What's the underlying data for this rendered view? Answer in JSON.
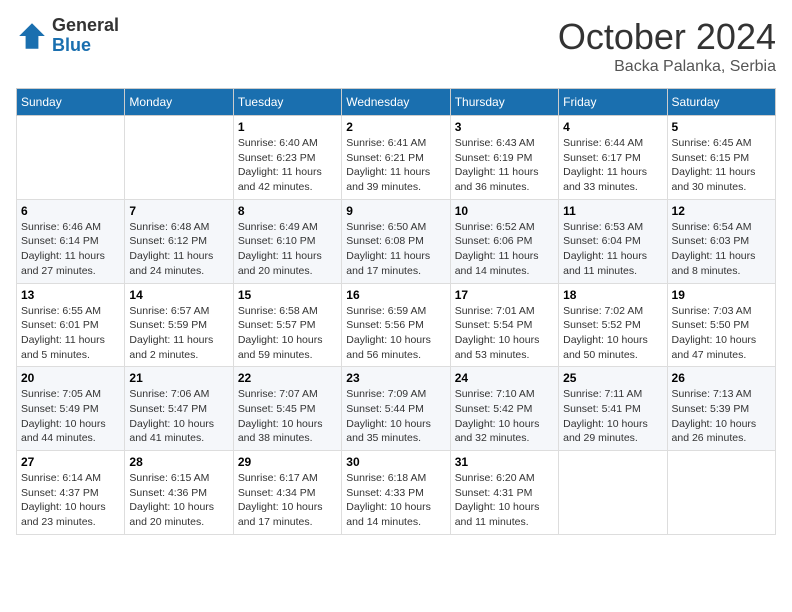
{
  "logo": {
    "general": "General",
    "blue": "Blue"
  },
  "title": {
    "month": "October 2024",
    "location": "Backa Palanka, Serbia"
  },
  "weekdays": [
    "Sunday",
    "Monday",
    "Tuesday",
    "Wednesday",
    "Thursday",
    "Friday",
    "Saturday"
  ],
  "weeks": [
    [
      {
        "day": "",
        "sunrise": "",
        "sunset": "",
        "daylight": ""
      },
      {
        "day": "",
        "sunrise": "",
        "sunset": "",
        "daylight": ""
      },
      {
        "day": "1",
        "sunrise": "Sunrise: 6:40 AM",
        "sunset": "Sunset: 6:23 PM",
        "daylight": "Daylight: 11 hours and 42 minutes."
      },
      {
        "day": "2",
        "sunrise": "Sunrise: 6:41 AM",
        "sunset": "Sunset: 6:21 PM",
        "daylight": "Daylight: 11 hours and 39 minutes."
      },
      {
        "day": "3",
        "sunrise": "Sunrise: 6:43 AM",
        "sunset": "Sunset: 6:19 PM",
        "daylight": "Daylight: 11 hours and 36 minutes."
      },
      {
        "day": "4",
        "sunrise": "Sunrise: 6:44 AM",
        "sunset": "Sunset: 6:17 PM",
        "daylight": "Daylight: 11 hours and 33 minutes."
      },
      {
        "day": "5",
        "sunrise": "Sunrise: 6:45 AM",
        "sunset": "Sunset: 6:15 PM",
        "daylight": "Daylight: 11 hours and 30 minutes."
      }
    ],
    [
      {
        "day": "6",
        "sunrise": "Sunrise: 6:46 AM",
        "sunset": "Sunset: 6:14 PM",
        "daylight": "Daylight: 11 hours and 27 minutes."
      },
      {
        "day": "7",
        "sunrise": "Sunrise: 6:48 AM",
        "sunset": "Sunset: 6:12 PM",
        "daylight": "Daylight: 11 hours and 24 minutes."
      },
      {
        "day": "8",
        "sunrise": "Sunrise: 6:49 AM",
        "sunset": "Sunset: 6:10 PM",
        "daylight": "Daylight: 11 hours and 20 minutes."
      },
      {
        "day": "9",
        "sunrise": "Sunrise: 6:50 AM",
        "sunset": "Sunset: 6:08 PM",
        "daylight": "Daylight: 11 hours and 17 minutes."
      },
      {
        "day": "10",
        "sunrise": "Sunrise: 6:52 AM",
        "sunset": "Sunset: 6:06 PM",
        "daylight": "Daylight: 11 hours and 14 minutes."
      },
      {
        "day": "11",
        "sunrise": "Sunrise: 6:53 AM",
        "sunset": "Sunset: 6:04 PM",
        "daylight": "Daylight: 11 hours and 11 minutes."
      },
      {
        "day": "12",
        "sunrise": "Sunrise: 6:54 AM",
        "sunset": "Sunset: 6:03 PM",
        "daylight": "Daylight: 11 hours and 8 minutes."
      }
    ],
    [
      {
        "day": "13",
        "sunrise": "Sunrise: 6:55 AM",
        "sunset": "Sunset: 6:01 PM",
        "daylight": "Daylight: 11 hours and 5 minutes."
      },
      {
        "day": "14",
        "sunrise": "Sunrise: 6:57 AM",
        "sunset": "Sunset: 5:59 PM",
        "daylight": "Daylight: 11 hours and 2 minutes."
      },
      {
        "day": "15",
        "sunrise": "Sunrise: 6:58 AM",
        "sunset": "Sunset: 5:57 PM",
        "daylight": "Daylight: 10 hours and 59 minutes."
      },
      {
        "day": "16",
        "sunrise": "Sunrise: 6:59 AM",
        "sunset": "Sunset: 5:56 PM",
        "daylight": "Daylight: 10 hours and 56 minutes."
      },
      {
        "day": "17",
        "sunrise": "Sunrise: 7:01 AM",
        "sunset": "Sunset: 5:54 PM",
        "daylight": "Daylight: 10 hours and 53 minutes."
      },
      {
        "day": "18",
        "sunrise": "Sunrise: 7:02 AM",
        "sunset": "Sunset: 5:52 PM",
        "daylight": "Daylight: 10 hours and 50 minutes."
      },
      {
        "day": "19",
        "sunrise": "Sunrise: 7:03 AM",
        "sunset": "Sunset: 5:50 PM",
        "daylight": "Daylight: 10 hours and 47 minutes."
      }
    ],
    [
      {
        "day": "20",
        "sunrise": "Sunrise: 7:05 AM",
        "sunset": "Sunset: 5:49 PM",
        "daylight": "Daylight: 10 hours and 44 minutes."
      },
      {
        "day": "21",
        "sunrise": "Sunrise: 7:06 AM",
        "sunset": "Sunset: 5:47 PM",
        "daylight": "Daylight: 10 hours and 41 minutes."
      },
      {
        "day": "22",
        "sunrise": "Sunrise: 7:07 AM",
        "sunset": "Sunset: 5:45 PM",
        "daylight": "Daylight: 10 hours and 38 minutes."
      },
      {
        "day": "23",
        "sunrise": "Sunrise: 7:09 AM",
        "sunset": "Sunset: 5:44 PM",
        "daylight": "Daylight: 10 hours and 35 minutes."
      },
      {
        "day": "24",
        "sunrise": "Sunrise: 7:10 AM",
        "sunset": "Sunset: 5:42 PM",
        "daylight": "Daylight: 10 hours and 32 minutes."
      },
      {
        "day": "25",
        "sunrise": "Sunrise: 7:11 AM",
        "sunset": "Sunset: 5:41 PM",
        "daylight": "Daylight: 10 hours and 29 minutes."
      },
      {
        "day": "26",
        "sunrise": "Sunrise: 7:13 AM",
        "sunset": "Sunset: 5:39 PM",
        "daylight": "Daylight: 10 hours and 26 minutes."
      }
    ],
    [
      {
        "day": "27",
        "sunrise": "Sunrise: 6:14 AM",
        "sunset": "Sunset: 4:37 PM",
        "daylight": "Daylight: 10 hours and 23 minutes."
      },
      {
        "day": "28",
        "sunrise": "Sunrise: 6:15 AM",
        "sunset": "Sunset: 4:36 PM",
        "daylight": "Daylight: 10 hours and 20 minutes."
      },
      {
        "day": "29",
        "sunrise": "Sunrise: 6:17 AM",
        "sunset": "Sunset: 4:34 PM",
        "daylight": "Daylight: 10 hours and 17 minutes."
      },
      {
        "day": "30",
        "sunrise": "Sunrise: 6:18 AM",
        "sunset": "Sunset: 4:33 PM",
        "daylight": "Daylight: 10 hours and 14 minutes."
      },
      {
        "day": "31",
        "sunrise": "Sunrise: 6:20 AM",
        "sunset": "Sunset: 4:31 PM",
        "daylight": "Daylight: 10 hours and 11 minutes."
      },
      {
        "day": "",
        "sunrise": "",
        "sunset": "",
        "daylight": ""
      },
      {
        "day": "",
        "sunrise": "",
        "sunset": "",
        "daylight": ""
      }
    ]
  ]
}
